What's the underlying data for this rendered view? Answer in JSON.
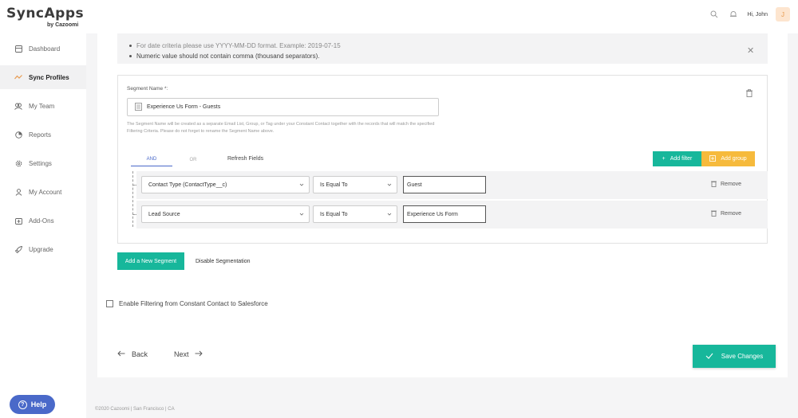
{
  "app": {
    "logo_text": "SyncApps",
    "logo_sub": "by Cazoomi",
    "greeting": "Hi, John",
    "avatar_initial": "J",
    "accent_color": "#17b79b",
    "brand_blue": "#4a69c9"
  },
  "sidebar": {
    "items": [
      {
        "label": "Dashboard",
        "icon": "dashboard-icon"
      },
      {
        "label": "Sync Profiles",
        "icon": "sync-icon",
        "active": true
      },
      {
        "label": "My Team",
        "icon": "team-icon"
      },
      {
        "label": "Reports",
        "icon": "reports-icon"
      },
      {
        "label": "Settings",
        "icon": "gear-icon"
      },
      {
        "label": "My Account",
        "icon": "user-icon"
      },
      {
        "label": "Add-Ons",
        "icon": "addons-icon"
      },
      {
        "label": "Upgrade",
        "icon": "rocket-icon"
      }
    ],
    "help_label": "Help"
  },
  "info": {
    "line1": "For date criteria please use YYYY-MM-DD format. Example: 2019-07-15",
    "line2": "Numeric value should not contain comma (thousand separators)."
  },
  "segment": {
    "label": "Segment Name *:",
    "name_value": "Experience Us Form - Guests",
    "help_text": "The Segment Name will be created as a separate Email List, Group, or Tag under your Constant Contact together with the records that will match the specified Filtering Criteria. Please do not forget to rename the Segment Name above.",
    "tabs": {
      "and": "AND",
      "or": "OR"
    },
    "refresh_label": "Refresh Fields",
    "add_filter_label": "Add filter",
    "add_group_label": "Add group",
    "rules": [
      {
        "field": "Contact Type (ContactType__c)",
        "operator": "Is Equal To",
        "value": "Guest",
        "remove_label": "Remove"
      },
      {
        "field": "Lead Source",
        "operator": "Is Equal To",
        "value": "Experience Us Form",
        "remove_label": "Remove"
      }
    ]
  },
  "actions": {
    "add_segment_label": "Add a New Segment",
    "disable_label": "Disable Segmentation",
    "enable_filter_label": "Enable Filtering from Constant Contact to Salesforce",
    "back_label": "Back",
    "next_label": "Next",
    "save_label": "Save Changes"
  },
  "footer": {
    "text": "©2020 Cazoomi | San Francisco | CA"
  }
}
